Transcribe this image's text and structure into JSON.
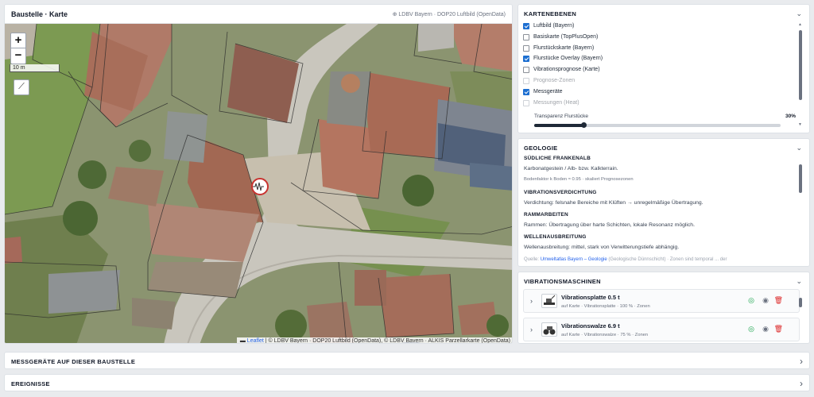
{
  "map": {
    "title": "Baustelle · Karte",
    "source": "⊕ LDBV Bayern · DOP20 Luftbild (OpenData)",
    "zoom_in": "+",
    "zoom_out": "−",
    "scale": "10 m",
    "attribution_link": "Leaflet",
    "attribution_text": " | © LDBV Bayern · DOP20 Luftbild (OpenData), © LDBV Bayern · ALKIS Parzellarkarte (OpenData)"
  },
  "layers": {
    "title": "KARTENEBENEN",
    "items": [
      {
        "label": "Luftbild (Bayern)",
        "checked": true,
        "disabled": false
      },
      {
        "label": "Basiskarte (TopPlusOpen)",
        "checked": false,
        "disabled": false
      },
      {
        "label": "Flurstückskarte (Bayern)",
        "checked": false,
        "disabled": false
      },
      {
        "label": "Flurstücke Overlay (Bayern)",
        "checked": true,
        "disabled": false
      },
      {
        "label": "Vibrationsprognose (Karte)",
        "checked": false,
        "disabled": false
      },
      {
        "label": "Prognose-Zonen",
        "checked": false,
        "disabled": true
      },
      {
        "label": "Messgeräte",
        "checked": true,
        "disabled": false
      },
      {
        "label": "Messungen (Heat)",
        "checked": false,
        "disabled": true
      }
    ],
    "transparency_label": "Transparenz Flurstücke",
    "transparency_value": "30%",
    "transparency_level": 0.2
  },
  "geology": {
    "title": "GEOLOGIE",
    "region_heading": "SÜDLICHE FRANKENALB",
    "region_text": "Karbonatgestein / Alb- bzw. Kalkterrain.",
    "factor_text": "Bodenfaktor k Boden ≈ 0.95 · skaliert Prognosezonen",
    "verdichtung_heading": "VIBRATIONSVERDICHTUNG",
    "verdichtung_text": "Verdichtung: felsnahe Bereiche mit Klüften → unregelmäßige Übertragung.",
    "rammarbeiten_heading": "RAMMARBEITEN",
    "rammarbeiten_text": "Rammen: Übertragung über harte Schichten, lokale Resonanz möglich.",
    "wellen_heading": "WELLENAUSBREITUNG",
    "wellen_text": "Wellenausbreitung: mittel, stark von Verwitterungstiefe abhängig.",
    "source_prefix": "Quelle: ",
    "source_link": "Umweltatlas Bayern – Geologie",
    "source_suffix": " (Geologische Dünnschicht) · Zonen sind temporal ... der"
  },
  "machines": {
    "title": "VIBRATIONSMASCHINEN",
    "items": [
      {
        "name": "Vibrationsplatte 0.5 t",
        "subtitle": "auf Karte · Vibrationsplatte · 100 % · Zonen"
      },
      {
        "name": "Vibrationswalze 6.9 t",
        "subtitle": "auf Karte · Vibrationswalze · 75 % · Zonen"
      }
    ]
  },
  "bars": {
    "messgeraete": "MESSGERÄTE AUF DIESER BAUSTELLE",
    "ereignisse": "EREIGNISSE"
  },
  "icons": {
    "device_marker": "vibration-sensor-icon",
    "collapse": "chevron-down-icon",
    "expand": "chevron-right-icon",
    "measure": "ruler-icon",
    "target": "target-icon",
    "eye": "eye-icon",
    "trash": "trash-icon"
  },
  "colors": {
    "accent": "#1d6fd1",
    "marker_red": "#c8322f",
    "target_green": "#16a34a",
    "trash_red": "#dc2626"
  }
}
